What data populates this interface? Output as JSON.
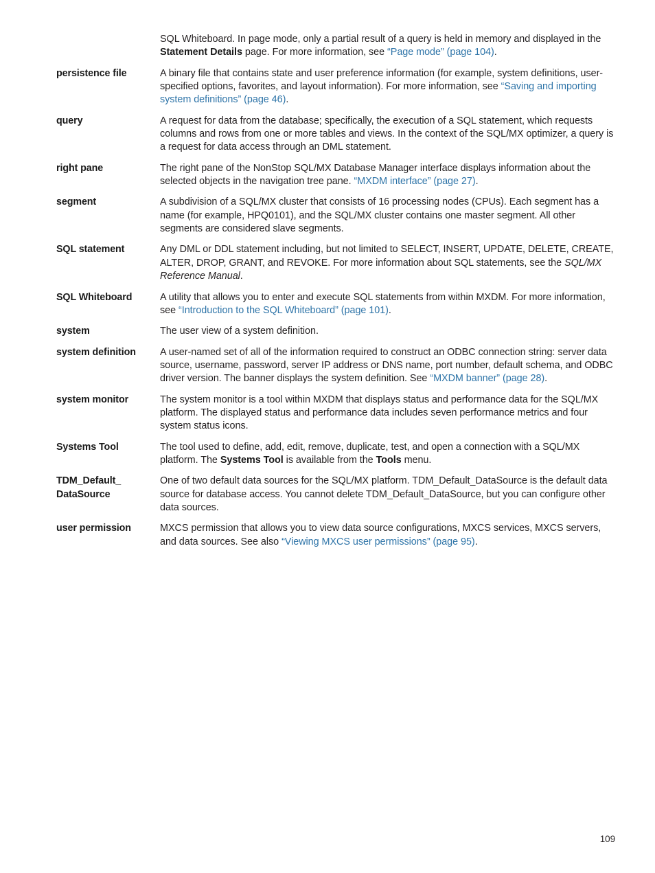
{
  "document": {
    "page_number": "109",
    "link_color": "#2e74a8",
    "text_color": "#231f20"
  },
  "glossary": {
    "entries": [
      {
        "term": "",
        "continuation": true,
        "parts": [
          {
            "type": "text",
            "text": "SQL Whiteboard. In page mode, only a partial result of a query is held in memory and displayed in the "
          },
          {
            "type": "bold",
            "text": "Statement Details"
          },
          {
            "type": "text",
            "text": " page. For more information, see "
          },
          {
            "type": "link",
            "text": "“Page mode” (page 104)"
          },
          {
            "type": "text",
            "text": "."
          }
        ]
      },
      {
        "term": "persistence file",
        "parts": [
          {
            "type": "text",
            "text": "A binary file that contains state and user preference information (for example, system definitions, user-specified options, favorites, and layout information). For more information, see "
          },
          {
            "type": "link",
            "text": "“Saving and importing system definitions” (page 46)"
          },
          {
            "type": "text",
            "text": "."
          }
        ]
      },
      {
        "term": "query",
        "parts": [
          {
            "type": "text",
            "text": "A request for data from the database; specifically, the execution of a SQL statement, which requests columns and rows from one or more tables and views. In the context of the SQL/MX optimizer, a query is a request for data access through an DML statement."
          }
        ]
      },
      {
        "term": "right pane",
        "parts": [
          {
            "type": "text",
            "text": "The right pane of the NonStop SQL/MX Database Manager interface displays information about the selected objects in the navigation tree pane. "
          },
          {
            "type": "link",
            "text": "“MXDM interface” (page 27)"
          },
          {
            "type": "text",
            "text": "."
          }
        ]
      },
      {
        "term": "segment",
        "parts": [
          {
            "type": "text",
            "text": "A subdivision of a SQL/MX cluster that consists of 16 processing nodes (CPUs). Each segment has a name (for example, HPQ0101), and the SQL/MX cluster contains one master segment. All other segments are considered slave segments."
          }
        ]
      },
      {
        "term": "SQL statement",
        "parts": [
          {
            "type": "text",
            "text": "Any DML or DDL statement including, but not limited to SELECT, INSERT, UPDATE, DELETE, CREATE, ALTER, DROP, GRANT, and REVOKE. For more information about SQL statements, see the "
          },
          {
            "type": "italic",
            "text": "SQL/MX Reference Manual"
          },
          {
            "type": "text",
            "text": "."
          }
        ]
      },
      {
        "term": "SQL Whiteboard",
        "parts": [
          {
            "type": "text",
            "text": "A utility that allows you to enter and execute SQL statements from within MXDM. For more information, see "
          },
          {
            "type": "link",
            "text": "“Introduction to the SQL Whiteboard” (page 101)"
          },
          {
            "type": "text",
            "text": "."
          }
        ]
      },
      {
        "term": "system",
        "parts": [
          {
            "type": "text",
            "text": "The user view of a system definition."
          }
        ]
      },
      {
        "term": "system definition",
        "parts": [
          {
            "type": "text",
            "text": "A user-named set of all of the information required to construct an ODBC connection string: server data source, username, password, server IP address or DNS name, port number, default schema, and ODBC driver version. The banner displays the system definition. See "
          },
          {
            "type": "link",
            "text": "“MXDM banner” (page 28)"
          },
          {
            "type": "text",
            "text": "."
          }
        ]
      },
      {
        "term": "system monitor",
        "parts": [
          {
            "type": "text",
            "text": "The system monitor is a tool within MXDM that displays status and performance data for the SQL/MX platform. The displayed status and performance data includes seven performance metrics and four system status icons."
          }
        ]
      },
      {
        "term": "Systems Tool",
        "parts": [
          {
            "type": "text",
            "text": "The tool used to define, add, edit, remove, duplicate, test, and open a connection with a SQL/MX platform. The "
          },
          {
            "type": "bold",
            "text": "Systems Tool"
          },
          {
            "type": "text",
            "text": " is available from the "
          },
          {
            "type": "bold",
            "text": "Tools"
          },
          {
            "type": "text",
            "text": " menu."
          }
        ]
      },
      {
        "term": "TDM_Default_ DataSource",
        "parts": [
          {
            "type": "text",
            "text": "One of two default data sources for the SQL/MX platform. TDM_Default_DataSource is the default data source for database access. You cannot delete TDM_Default_DataSource, but you can configure other data sources."
          }
        ]
      },
      {
        "term": "user permission",
        "parts": [
          {
            "type": "text",
            "text": "MXCS permission that allows you to view data source configurations, MXCS services, MXCS servers, and data sources. See also "
          },
          {
            "type": "link",
            "text": "“Viewing MXCS user permissions” (page 95)"
          },
          {
            "type": "text",
            "text": "."
          }
        ]
      }
    ]
  }
}
